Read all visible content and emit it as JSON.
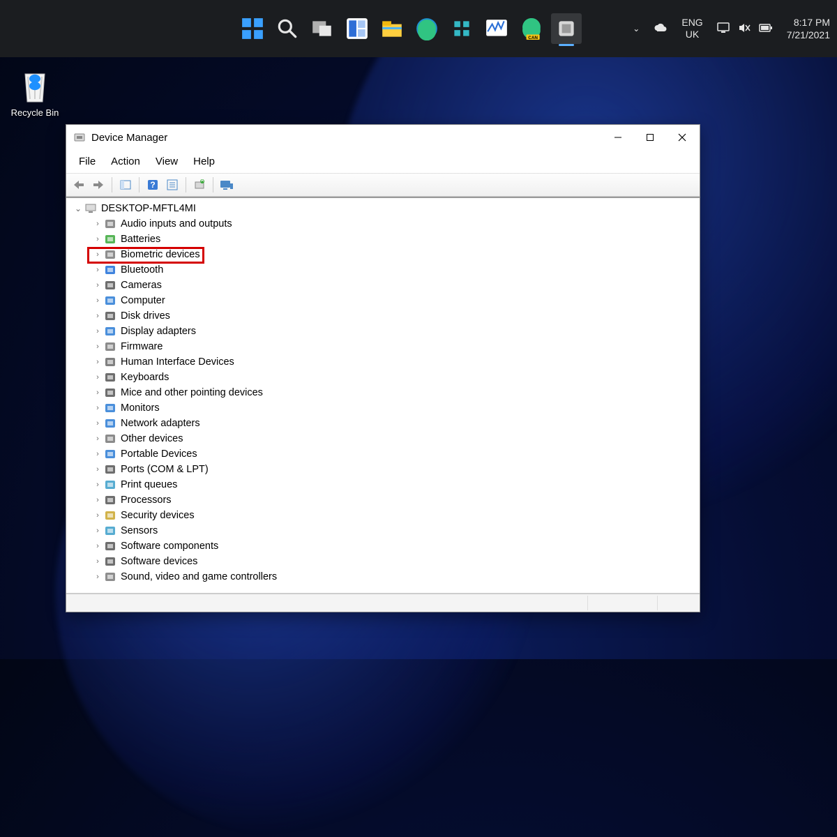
{
  "taskbar": {
    "icons": [
      {
        "name": "start-icon"
      },
      {
        "name": "search-icon"
      },
      {
        "name": "task-view-icon"
      },
      {
        "name": "widgets-icon"
      },
      {
        "name": "file-explorer-icon"
      },
      {
        "name": "edge-browser-icon"
      },
      {
        "name": "unknown-app-icon"
      },
      {
        "name": "screenshot-app-icon"
      },
      {
        "name": "edge-canary-icon",
        "badge": "CAN"
      },
      {
        "name": "device-manager-icon",
        "active": true
      }
    ],
    "language_top": "ENG",
    "language_bottom": "UK",
    "time": "8:17 PM",
    "date": "7/21/2021"
  },
  "desktop": {
    "recycle_bin_label": "Recycle Bin"
  },
  "device_manager": {
    "title": "Device Manager",
    "menu": {
      "file": "File",
      "action": "Action",
      "view": "View",
      "help": "Help"
    },
    "toolbar_buttons": [
      "back",
      "forward",
      "|",
      "home",
      "help",
      "refresh",
      "update",
      "|",
      "scan",
      "|",
      "devices"
    ],
    "root_name": "DESKTOP-MFTL4MI",
    "categories": [
      {
        "label": "Audio inputs and outputs",
        "icon": "audio-icon"
      },
      {
        "label": "Batteries",
        "icon": "battery-icon"
      },
      {
        "label": "Biometric devices",
        "icon": "biometric-icon",
        "highlighted": true
      },
      {
        "label": "Bluetooth",
        "icon": "bluetooth-icon"
      },
      {
        "label": "Cameras",
        "icon": "camera-icon"
      },
      {
        "label": "Computer",
        "icon": "computer-icon"
      },
      {
        "label": "Disk drives",
        "icon": "disk-icon"
      },
      {
        "label": "Display adapters",
        "icon": "display-icon"
      },
      {
        "label": "Firmware",
        "icon": "firmware-icon"
      },
      {
        "label": "Human Interface Devices",
        "icon": "hid-icon"
      },
      {
        "label": "Keyboards",
        "icon": "keyboard-icon"
      },
      {
        "label": "Mice and other pointing devices",
        "icon": "mouse-icon"
      },
      {
        "label": "Monitors",
        "icon": "monitor-icon"
      },
      {
        "label": "Network adapters",
        "icon": "network-icon"
      },
      {
        "label": "Other devices",
        "icon": "other-icon"
      },
      {
        "label": "Portable Devices",
        "icon": "portable-icon"
      },
      {
        "label": "Ports (COM & LPT)",
        "icon": "ports-icon"
      },
      {
        "label": "Print queues",
        "icon": "printer-icon"
      },
      {
        "label": "Processors",
        "icon": "cpu-icon"
      },
      {
        "label": "Security devices",
        "icon": "security-icon"
      },
      {
        "label": "Sensors",
        "icon": "sensor-icon"
      },
      {
        "label": "Software components",
        "icon": "software-comp-icon"
      },
      {
        "label": "Software devices",
        "icon": "software-dev-icon"
      },
      {
        "label": "Sound, video and game controllers",
        "icon": "sound-icon"
      }
    ]
  }
}
